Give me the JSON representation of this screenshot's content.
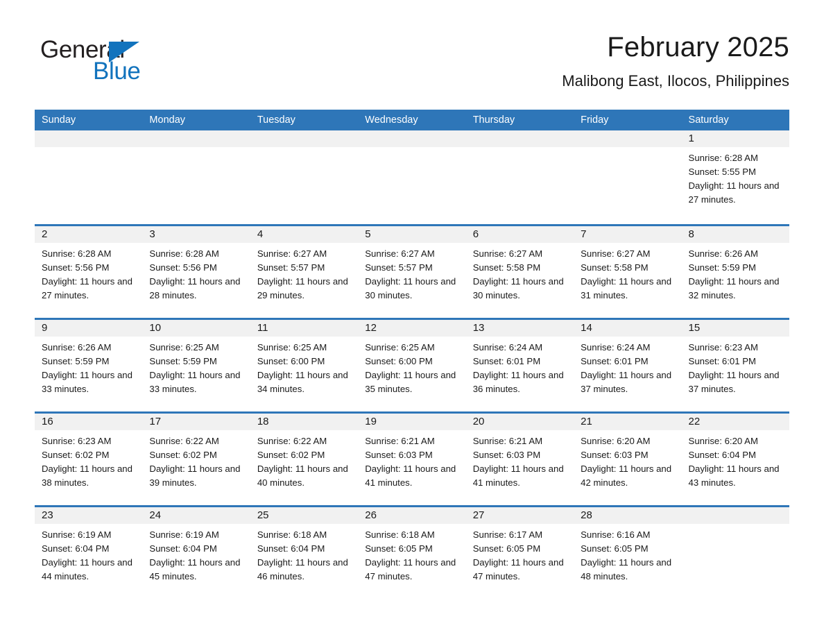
{
  "brand": {
    "name_part1": "General",
    "name_part2": "Blue",
    "accent_color": "#1273bd"
  },
  "header": {
    "title": "February 2025",
    "subtitle": "Malibong East, Ilocos, Philippines"
  },
  "calendar": {
    "header_bg": "#2e76b8",
    "day_band_bg": "#f1f1f1",
    "weekday_headers": [
      "Sunday",
      "Monday",
      "Tuesday",
      "Wednesday",
      "Thursday",
      "Friday",
      "Saturday"
    ],
    "weeks": [
      [
        {
          "day": "",
          "sunrise": "",
          "sunset": "",
          "daylight": ""
        },
        {
          "day": "",
          "sunrise": "",
          "sunset": "",
          "daylight": ""
        },
        {
          "day": "",
          "sunrise": "",
          "sunset": "",
          "daylight": ""
        },
        {
          "day": "",
          "sunrise": "",
          "sunset": "",
          "daylight": ""
        },
        {
          "day": "",
          "sunrise": "",
          "sunset": "",
          "daylight": ""
        },
        {
          "day": "",
          "sunrise": "",
          "sunset": "",
          "daylight": ""
        },
        {
          "day": "1",
          "sunrise": "Sunrise: 6:28 AM",
          "sunset": "Sunset: 5:55 PM",
          "daylight": "Daylight: 11 hours and 27 minutes."
        }
      ],
      [
        {
          "day": "2",
          "sunrise": "Sunrise: 6:28 AM",
          "sunset": "Sunset: 5:56 PM",
          "daylight": "Daylight: 11 hours and 27 minutes."
        },
        {
          "day": "3",
          "sunrise": "Sunrise: 6:28 AM",
          "sunset": "Sunset: 5:56 PM",
          "daylight": "Daylight: 11 hours and 28 minutes."
        },
        {
          "day": "4",
          "sunrise": "Sunrise: 6:27 AM",
          "sunset": "Sunset: 5:57 PM",
          "daylight": "Daylight: 11 hours and 29 minutes."
        },
        {
          "day": "5",
          "sunrise": "Sunrise: 6:27 AM",
          "sunset": "Sunset: 5:57 PM",
          "daylight": "Daylight: 11 hours and 30 minutes."
        },
        {
          "day": "6",
          "sunrise": "Sunrise: 6:27 AM",
          "sunset": "Sunset: 5:58 PM",
          "daylight": "Daylight: 11 hours and 30 minutes."
        },
        {
          "day": "7",
          "sunrise": "Sunrise: 6:27 AM",
          "sunset": "Sunset: 5:58 PM",
          "daylight": "Daylight: 11 hours and 31 minutes."
        },
        {
          "day": "8",
          "sunrise": "Sunrise: 6:26 AM",
          "sunset": "Sunset: 5:59 PM",
          "daylight": "Daylight: 11 hours and 32 minutes."
        }
      ],
      [
        {
          "day": "9",
          "sunrise": "Sunrise: 6:26 AM",
          "sunset": "Sunset: 5:59 PM",
          "daylight": "Daylight: 11 hours and 33 minutes."
        },
        {
          "day": "10",
          "sunrise": "Sunrise: 6:25 AM",
          "sunset": "Sunset: 5:59 PM",
          "daylight": "Daylight: 11 hours and 33 minutes."
        },
        {
          "day": "11",
          "sunrise": "Sunrise: 6:25 AM",
          "sunset": "Sunset: 6:00 PM",
          "daylight": "Daylight: 11 hours and 34 minutes."
        },
        {
          "day": "12",
          "sunrise": "Sunrise: 6:25 AM",
          "sunset": "Sunset: 6:00 PM",
          "daylight": "Daylight: 11 hours and 35 minutes."
        },
        {
          "day": "13",
          "sunrise": "Sunrise: 6:24 AM",
          "sunset": "Sunset: 6:01 PM",
          "daylight": "Daylight: 11 hours and 36 minutes."
        },
        {
          "day": "14",
          "sunrise": "Sunrise: 6:24 AM",
          "sunset": "Sunset: 6:01 PM",
          "daylight": "Daylight: 11 hours and 37 minutes."
        },
        {
          "day": "15",
          "sunrise": "Sunrise: 6:23 AM",
          "sunset": "Sunset: 6:01 PM",
          "daylight": "Daylight: 11 hours and 37 minutes."
        }
      ],
      [
        {
          "day": "16",
          "sunrise": "Sunrise: 6:23 AM",
          "sunset": "Sunset: 6:02 PM",
          "daylight": "Daylight: 11 hours and 38 minutes."
        },
        {
          "day": "17",
          "sunrise": "Sunrise: 6:22 AM",
          "sunset": "Sunset: 6:02 PM",
          "daylight": "Daylight: 11 hours and 39 minutes."
        },
        {
          "day": "18",
          "sunrise": "Sunrise: 6:22 AM",
          "sunset": "Sunset: 6:02 PM",
          "daylight": "Daylight: 11 hours and 40 minutes."
        },
        {
          "day": "19",
          "sunrise": "Sunrise: 6:21 AM",
          "sunset": "Sunset: 6:03 PM",
          "daylight": "Daylight: 11 hours and 41 minutes."
        },
        {
          "day": "20",
          "sunrise": "Sunrise: 6:21 AM",
          "sunset": "Sunset: 6:03 PM",
          "daylight": "Daylight: 11 hours and 41 minutes."
        },
        {
          "day": "21",
          "sunrise": "Sunrise: 6:20 AM",
          "sunset": "Sunset: 6:03 PM",
          "daylight": "Daylight: 11 hours and 42 minutes."
        },
        {
          "day": "22",
          "sunrise": "Sunrise: 6:20 AM",
          "sunset": "Sunset: 6:04 PM",
          "daylight": "Daylight: 11 hours and 43 minutes."
        }
      ],
      [
        {
          "day": "23",
          "sunrise": "Sunrise: 6:19 AM",
          "sunset": "Sunset: 6:04 PM",
          "daylight": "Daylight: 11 hours and 44 minutes."
        },
        {
          "day": "24",
          "sunrise": "Sunrise: 6:19 AM",
          "sunset": "Sunset: 6:04 PM",
          "daylight": "Daylight: 11 hours and 45 minutes."
        },
        {
          "day": "25",
          "sunrise": "Sunrise: 6:18 AM",
          "sunset": "Sunset: 6:04 PM",
          "daylight": "Daylight: 11 hours and 46 minutes."
        },
        {
          "day": "26",
          "sunrise": "Sunrise: 6:18 AM",
          "sunset": "Sunset: 6:05 PM",
          "daylight": "Daylight: 11 hours and 47 minutes."
        },
        {
          "day": "27",
          "sunrise": "Sunrise: 6:17 AM",
          "sunset": "Sunset: 6:05 PM",
          "daylight": "Daylight: 11 hours and 47 minutes."
        },
        {
          "day": "28",
          "sunrise": "Sunrise: 6:16 AM",
          "sunset": "Sunset: 6:05 PM",
          "daylight": "Daylight: 11 hours and 48 minutes."
        },
        {
          "day": "",
          "sunrise": "",
          "sunset": "",
          "daylight": ""
        }
      ]
    ]
  }
}
